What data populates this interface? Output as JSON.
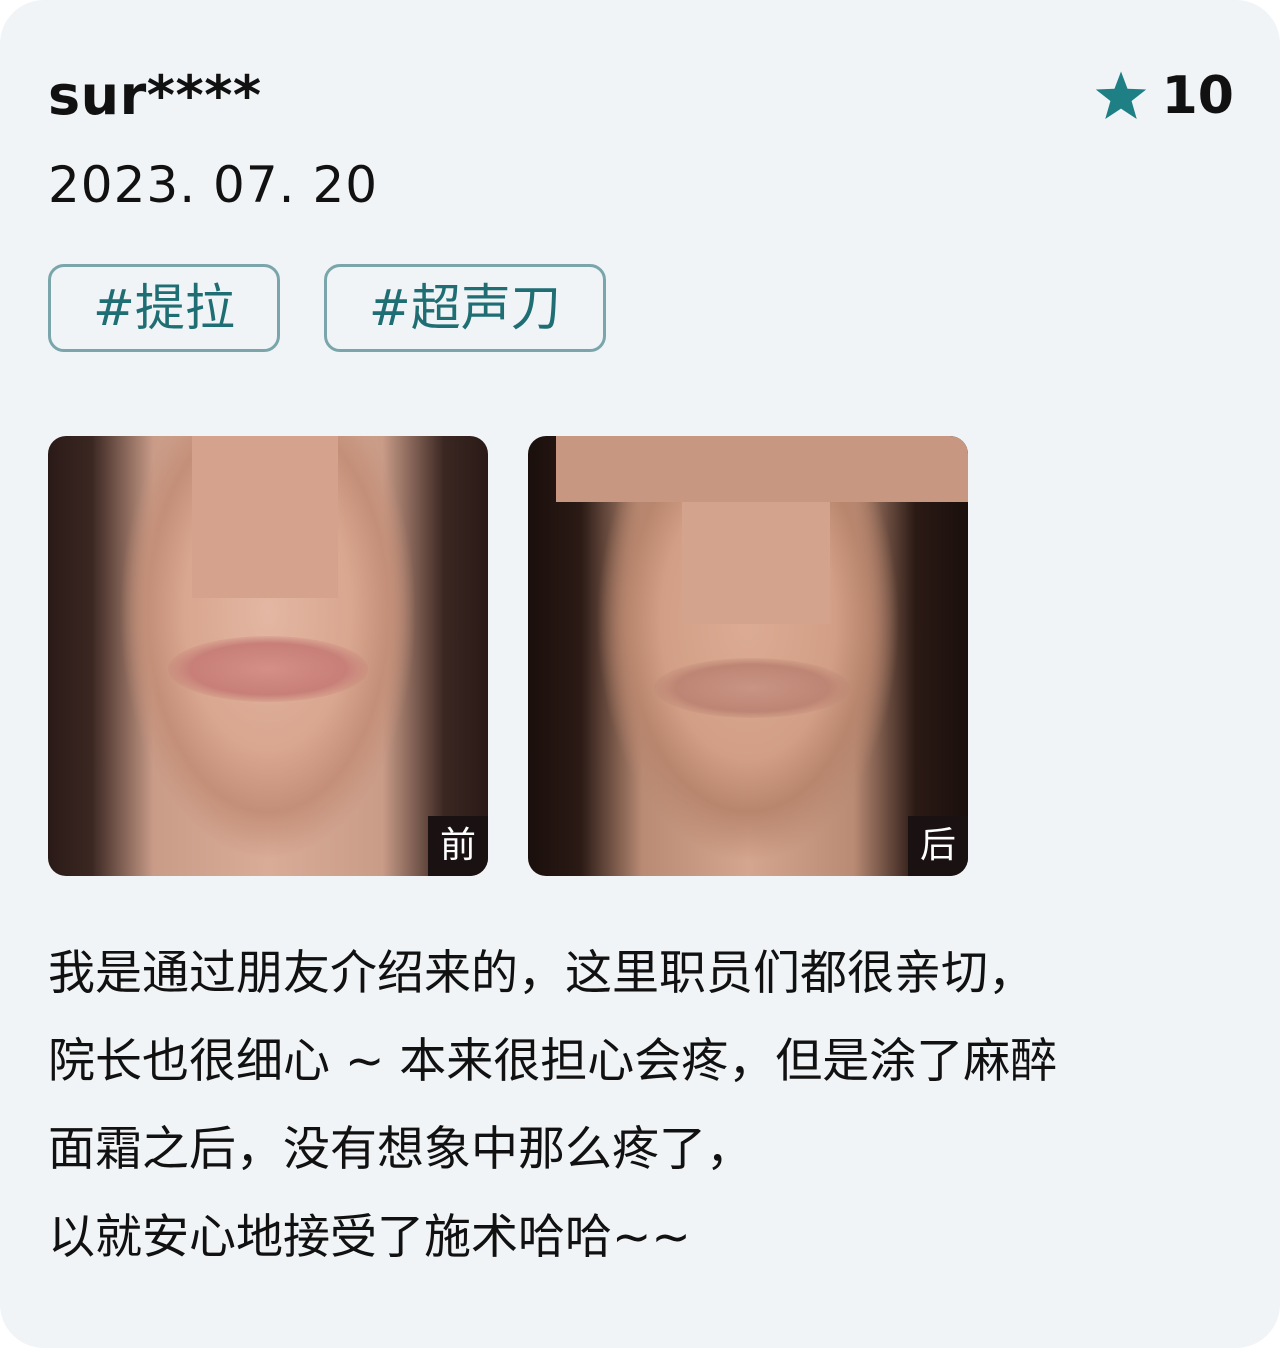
{
  "review": {
    "username": "sur****",
    "rating": {
      "icon": "star-icon",
      "value": "10",
      "icon_color": "#1e7f85"
    },
    "date": "2023. 07. 20",
    "tags": [
      "#提拉",
      "#超声刀"
    ],
    "photos": [
      {
        "label": "前",
        "description_icon": "face-photo"
      },
      {
        "label": "后",
        "description_icon": "face-photo"
      }
    ],
    "text_lines": [
      "我是通过朋友介绍来的，这里职员们都很亲切，",
      "院长也很细心 ~ 本来很担心会疼，但是涂了麻醉",
      "面霜之后，没有想象中那么疼了，",
      "以就安心地接受了施术哈哈~~"
    ]
  },
  "colors": {
    "card_background": "#f0f4f6",
    "tag_border": "#7aa6ab",
    "tag_text": "#1e6e73",
    "text": "#111111"
  }
}
